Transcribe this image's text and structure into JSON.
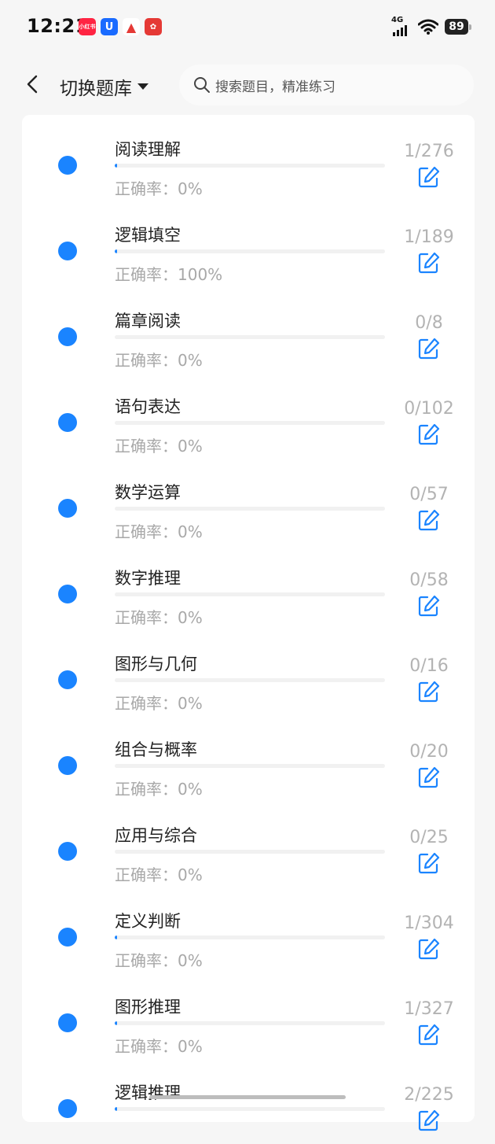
{
  "status_bar": {
    "time": "12:21",
    "network": "4G",
    "battery": "89"
  },
  "header": {
    "bank_title": "切换题库",
    "search_placeholder": "搜索题目，精准练习"
  },
  "list": [
    {
      "title": "阅读理解",
      "accuracy": "正确率：0%",
      "count": "1/276",
      "progress": 0.0036
    },
    {
      "title": "逻辑填空",
      "accuracy": "正确率：100%",
      "count": "1/189",
      "progress": 0.0053
    },
    {
      "title": "篇章阅读",
      "accuracy": "正确率：0%",
      "count": "0/8",
      "progress": 0
    },
    {
      "title": "语句表达",
      "accuracy": "正确率：0%",
      "count": "0/102",
      "progress": 0
    },
    {
      "title": "数学运算",
      "accuracy": "正确率：0%",
      "count": "0/57",
      "progress": 0
    },
    {
      "title": "数字推理",
      "accuracy": "正确率：0%",
      "count": "0/58",
      "progress": 0
    },
    {
      "title": "图形与几何",
      "accuracy": "正确率：0%",
      "count": "0/16",
      "progress": 0
    },
    {
      "title": "组合与概率",
      "accuracy": "正确率：0%",
      "count": "0/20",
      "progress": 0
    },
    {
      "title": "应用与综合",
      "accuracy": "正确率：0%",
      "count": "0/25",
      "progress": 0
    },
    {
      "title": "定义判断",
      "accuracy": "正确率：0%",
      "count": "1/304",
      "progress": 0.0033
    },
    {
      "title": "图形推理",
      "accuracy": "正确率：0%",
      "count": "1/327",
      "progress": 0.0031
    },
    {
      "title": "逻辑推理",
      "accuracy": "",
      "count": "2/225",
      "progress": 0.0089
    }
  ],
  "colors": {
    "accent": "#1a84ff",
    "muted": "#a8a8a8",
    "background": "#f6f6f6"
  }
}
